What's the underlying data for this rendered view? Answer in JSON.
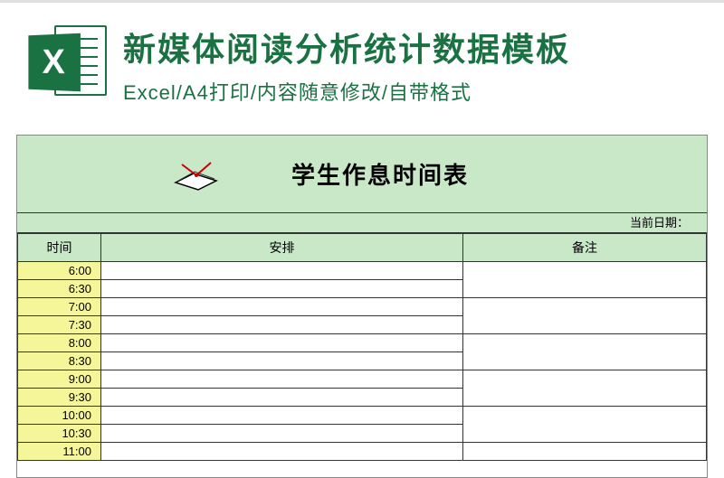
{
  "header": {
    "title": "新媒体阅读分析统计数据模板",
    "subtitle": "Excel/A4打印/内容随意修改/自带格式",
    "icon_letter": "X"
  },
  "sheet": {
    "title": "学生作息时间表",
    "date_label": "当前日期：",
    "columns": {
      "time": "时间",
      "arrangement": "安排",
      "remark": "备注"
    },
    "rows": [
      {
        "time": "6:00",
        "arrangement": "",
        "remark": ""
      },
      {
        "time": "6:30",
        "arrangement": "",
        "remark": ""
      },
      {
        "time": "7:00",
        "arrangement": "",
        "remark": ""
      },
      {
        "time": "7:30",
        "arrangement": "",
        "remark": ""
      },
      {
        "time": "8:00",
        "arrangement": "",
        "remark": ""
      },
      {
        "time": "8:30",
        "arrangement": "",
        "remark": ""
      },
      {
        "time": "9:00",
        "arrangement": "",
        "remark": ""
      },
      {
        "time": "9:30",
        "arrangement": "",
        "remark": ""
      },
      {
        "time": "10:00",
        "arrangement": "",
        "remark": ""
      },
      {
        "time": "10:30",
        "arrangement": "",
        "remark": ""
      },
      {
        "time": "11:00",
        "arrangement": "",
        "remark": ""
      }
    ]
  }
}
